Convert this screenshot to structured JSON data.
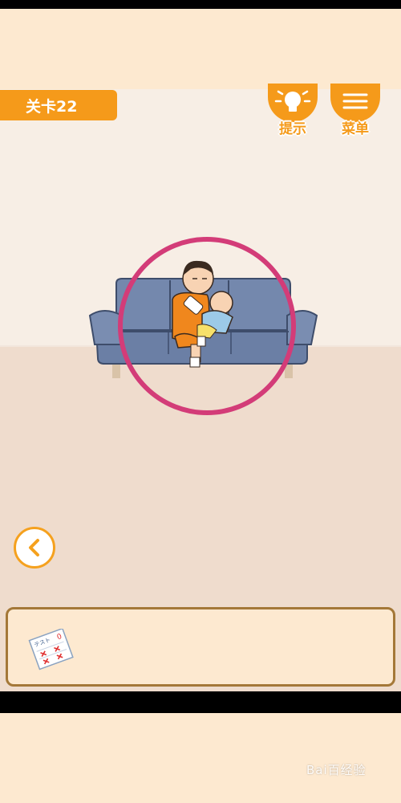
{
  "level": {
    "label": "关卡22"
  },
  "hint": {
    "label": "提示",
    "icon": "lightbulb-icon"
  },
  "menu": {
    "label": "菜单",
    "icon": "hamburger-menu-icon"
  },
  "back": {
    "icon": "chevron-left-icon"
  },
  "inventory": {
    "items": [
      {
        "icon": "test-paper-icon",
        "paper_text": "テスト"
      }
    ]
  },
  "watermark": {
    "text": "Bai百经验"
  },
  "colors": {
    "accent": "#f59a1a",
    "highlight_circle": "#d33c78",
    "sofa": "#6b7fa5",
    "wall": "#f7eee5",
    "floor": "#efdccd",
    "background": "#fde9d0"
  }
}
